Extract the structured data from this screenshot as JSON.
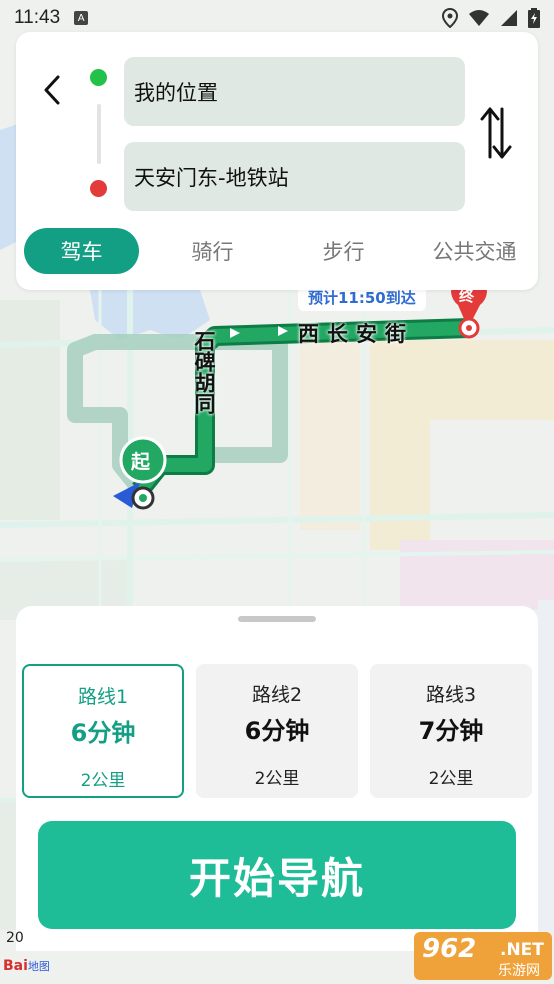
{
  "status_bar": {
    "time": "11:43",
    "notif_badge": "A",
    "icons": [
      "location-icon",
      "wifi-icon",
      "signal-icon",
      "battery-icon"
    ]
  },
  "route_form": {
    "from": "我的位置",
    "to": "天安门东-地铁站"
  },
  "modes": [
    {
      "label": "驾车",
      "active": true
    },
    {
      "label": "骑行",
      "active": false
    },
    {
      "label": "步行",
      "active": false
    },
    {
      "label": "公共交通",
      "active": false
    }
  ],
  "map": {
    "eta_label": "预计11:50到达",
    "street_1": "西长安街",
    "street_2": "石碑胡同",
    "start_marker": "起",
    "end_marker": "终",
    "scale_label": "20"
  },
  "routes": [
    {
      "name": "路线1",
      "time": "6分钟",
      "distance": "2公里",
      "selected": true
    },
    {
      "name": "路线2",
      "time": "6分钟",
      "distance": "2公里",
      "selected": false
    },
    {
      "name": "路线3",
      "time": "7分钟",
      "distance": "2公里",
      "selected": false
    }
  ],
  "start_button": "开始导航",
  "branding": {
    "map_logo": "Bai",
    "map_logo_sub": "地图",
    "watermark_main": "962",
    "watermark_net": ".NET",
    "watermark_sub": "乐游网"
  },
  "colors": {
    "accent": "#139f83",
    "button": "#1fbc98",
    "route": "#1a9b5b",
    "start_dot": "#22c14a",
    "end_dot": "#e33a3a"
  }
}
